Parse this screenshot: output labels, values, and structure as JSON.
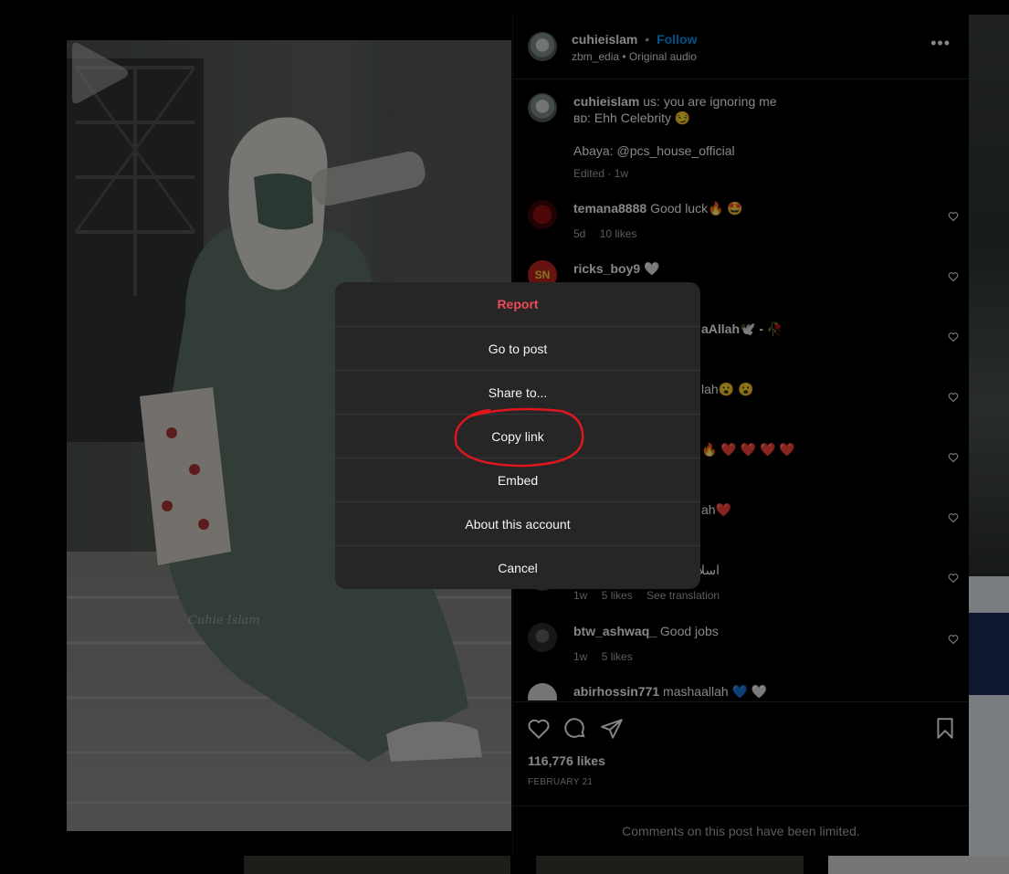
{
  "post": {
    "author": "cuhieislam",
    "follow_label": "Follow",
    "dot": "•",
    "audio_user": "zbm_edia",
    "audio_label": "Original audio",
    "watermark": "Cuhie Islam",
    "more_label": "•••"
  },
  "caption": {
    "user": "cuhieislam",
    "line1": "us: you are ignoring me",
    "line2": "ʙᴅ: Ehh Celebrity 😏",
    "line3": "Abaya: @pcs_house_official",
    "meta": "Edited · 1w"
  },
  "comments": [
    {
      "user": "temana8888",
      "text": "Good luck🔥 🤩",
      "time": "5d",
      "likes": "10 likes"
    },
    {
      "user": "ricks_boy9",
      "text": "🤍"
    },
    {
      "user": "",
      "text": "aAllah🕊️ - 🥀"
    },
    {
      "user": "",
      "text": "lah😮 😮"
    },
    {
      "user": "",
      "text": "🔥 ❤️ ❤️ ❤️ ❤️"
    },
    {
      "user": "",
      "text": "ah❤️"
    },
    {
      "user": "",
      "text": "اسلا",
      "time": "1w",
      "likes": "5 likes",
      "extra": "See translation"
    },
    {
      "user": "btw_ashwaq_",
      "text": "Good jobs",
      "time": "1w",
      "likes": "5 likes"
    },
    {
      "user": "abirhossin771",
      "text": "mashaallah 💙 🤍"
    }
  ],
  "likes_count": "116,776 likes",
  "post_date": "FEBRUARY 21",
  "limited_text": "Comments on this post have been limited.",
  "modal": {
    "report": "Report",
    "go_to_post": "Go to post",
    "share_to": "Share to...",
    "copy_link": "Copy link",
    "embed": "Embed",
    "about_account": "About this account",
    "cancel": "Cancel"
  },
  "colors": {
    "danger": "#ed4956",
    "link": "#0095f6",
    "annotation": "#e0161e",
    "modal_bg": "#262626"
  }
}
